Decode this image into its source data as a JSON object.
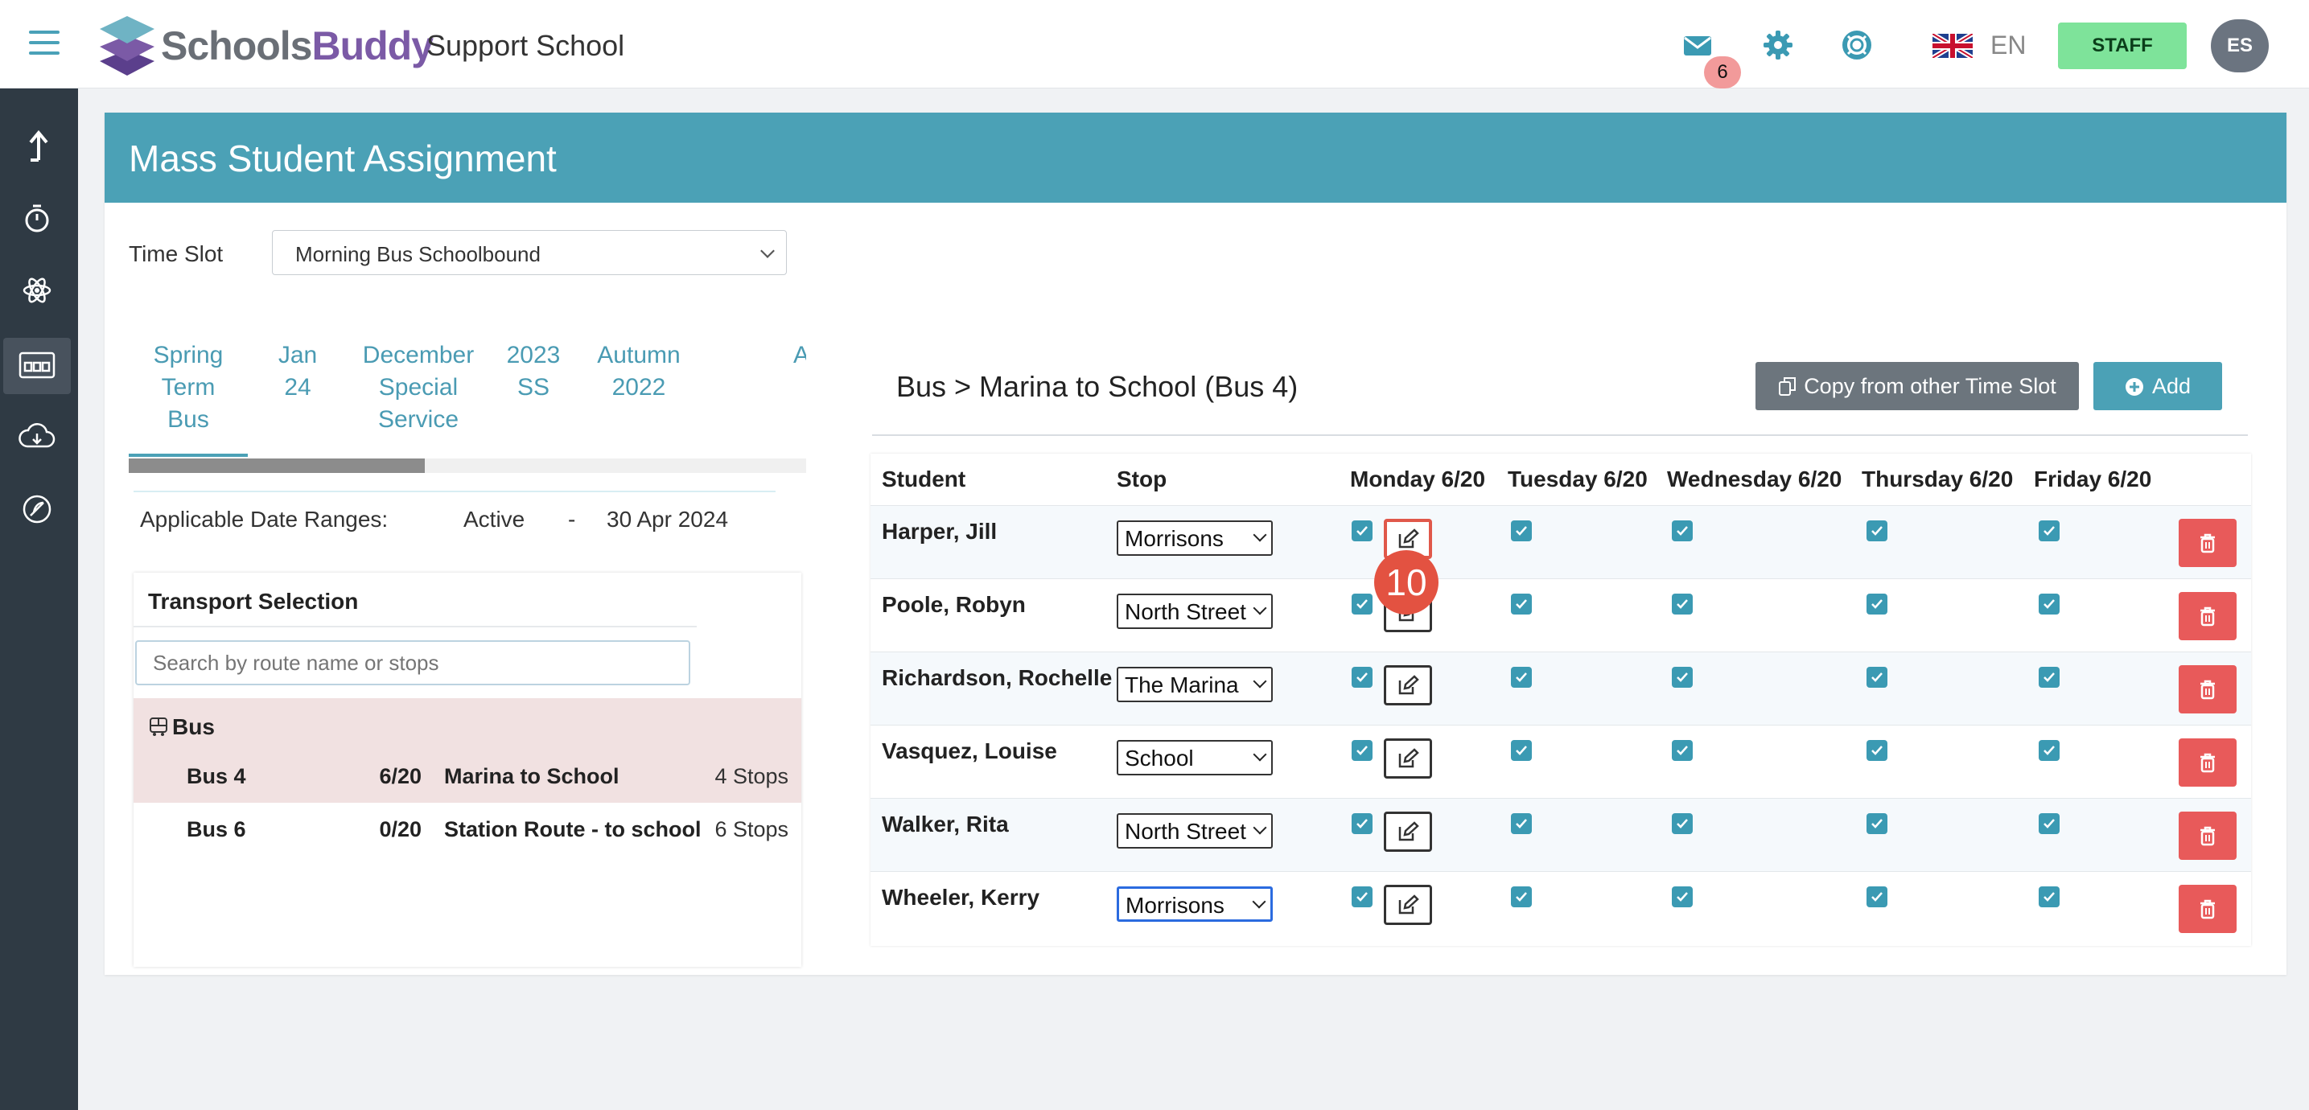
{
  "header": {
    "brand_part1": "Schools",
    "brand_part2": "Buddy",
    "school_name": "Support School",
    "messages_count": "6",
    "language": "EN",
    "staff_label": "STAFF",
    "avatar_initials": "ES",
    "icons": [
      "menu-icon",
      "mail-icon",
      "gear-icon",
      "lifebuoy-icon",
      "uk-flag-icon"
    ]
  },
  "sidebar": {
    "icons": [
      "upload-arrow-icon",
      "stopwatch-icon",
      "atom-icon",
      "bus-seats-icon",
      "cloud-download-icon",
      "feather-icon"
    ],
    "active_index": 3
  },
  "page": {
    "title": "Mass Student Assignment",
    "time_slot_label": "Time Slot",
    "time_slot_value": "Morning Bus Schoolbound"
  },
  "tabs": [
    {
      "label": "Spring\nTerm\nBus"
    },
    {
      "label": "Jan\n24"
    },
    {
      "label": "December\nSpecial\nService"
    },
    {
      "label": "2023\nSS"
    },
    {
      "label": "Autumn\n2022"
    },
    {
      "label": "A"
    }
  ],
  "date_ranges": {
    "label": "Applicable Date Ranges:",
    "start": "Active",
    "separator": "-",
    "end": "30 Apr 2024"
  },
  "transport": {
    "title": "Transport Selection",
    "search_placeholder": "Search by route name or stops",
    "group_label": "Bus",
    "routes": [
      {
        "bus": "Bus 4",
        "capacity": "6/20",
        "name": "Marina to School",
        "stops": "4 Stops",
        "selected": true
      },
      {
        "bus": "Bus 6",
        "capacity": "0/20",
        "name": "Station Route - to school",
        "stops": "6 Stops",
        "selected": false
      }
    ]
  },
  "assignment": {
    "title": "Bus > Marina to School (Bus 4)",
    "copy_label": "Copy from other Time Slot",
    "add_label": "Add",
    "columns": [
      "Student",
      "Stop",
      "Monday 6/20",
      "Tuesday 6/20",
      "Wednesday 6/20",
      "Thursday 6/20",
      "Friday 6/20"
    ],
    "rows": [
      {
        "student": "Harper, Jill",
        "stop": "Morrisons"
      },
      {
        "student": "Poole, Robyn",
        "stop": "North Street"
      },
      {
        "student": "Richardson, Rochelle",
        "stop": "The Marina"
      },
      {
        "student": "Vasquez, Louise",
        "stop": "School"
      },
      {
        "student": "Walker, Rita",
        "stop": "North Street"
      },
      {
        "student": "Wheeler, Kerry",
        "stop": "Morrisons"
      }
    ],
    "step_marker": "10"
  },
  "colors": {
    "accent": "#4ba1b6",
    "sidebar": "#2f3a44",
    "delete": "#e85a5a",
    "selected_route": "#f1e1e1",
    "staff": "#7ee39a",
    "step_marker": "#e35241"
  }
}
